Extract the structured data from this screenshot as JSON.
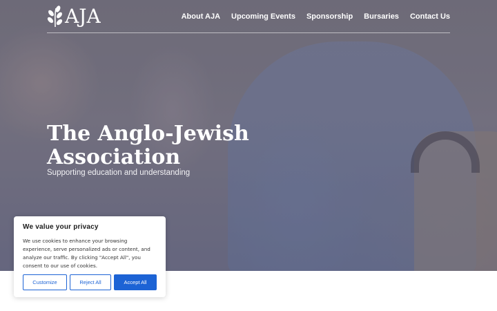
{
  "header": {
    "logo_text": "AJA",
    "nav": [
      {
        "label": "About AJA"
      },
      {
        "label": "Upcoming Events"
      },
      {
        "label": "Sponsorship"
      },
      {
        "label": "Bursaries"
      },
      {
        "label": "Contact Us"
      }
    ]
  },
  "hero": {
    "title": "The Anglo-Jewish Association",
    "subtitle": "Supporting education and understanding"
  },
  "cookie_banner": {
    "title": "We value your privacy",
    "text": "We use cookies to enhance your browsing experience, serve personalized ads or content, and analyze our traffic. By clicking \"Accept All\", you consent to our use of cookies.",
    "customize_label": "Customize",
    "reject_label": "Reject All",
    "accept_label": "Accept All"
  },
  "colors": {
    "accent": "#1c63d5",
    "hero_text": "#ffffff"
  }
}
